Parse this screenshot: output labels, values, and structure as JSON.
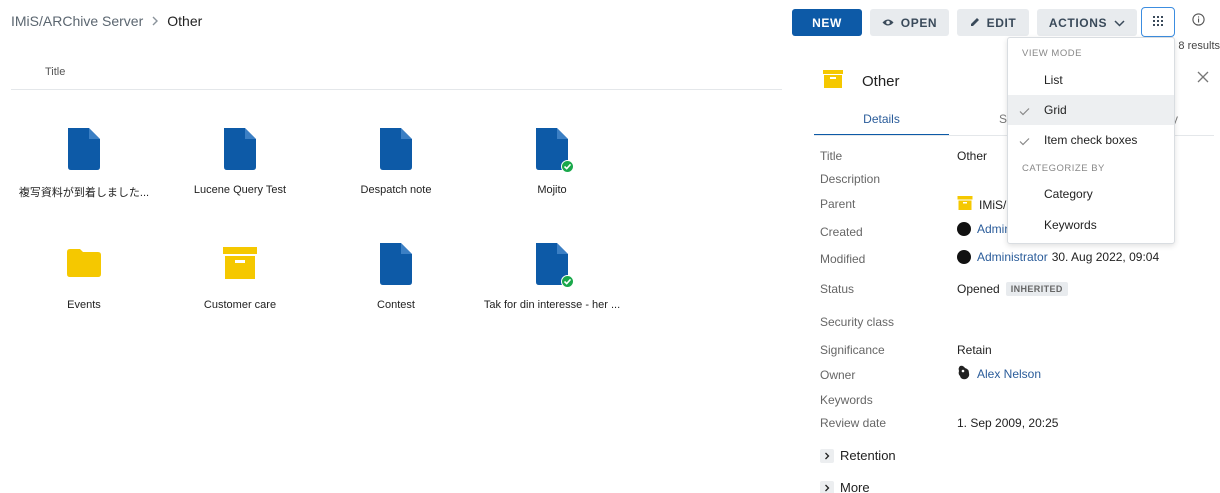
{
  "breadcrumb": {
    "root": "IMiS/ARChive Server",
    "current": "Other"
  },
  "list": {
    "column_title": "Title",
    "items": [
      {
        "label": "複写資料が到着しました...",
        "icon": "document-icon",
        "status_badge": false
      },
      {
        "label": "Lucene Query Test",
        "icon": "document-icon",
        "status_badge": false
      },
      {
        "label": "Despatch note",
        "icon": "document-icon",
        "status_badge": false
      },
      {
        "label": "Mojito",
        "icon": "document-icon",
        "status_badge": true
      },
      {
        "label": "Events",
        "icon": "folder-icon",
        "status_badge": false
      },
      {
        "label": "Customer care",
        "icon": "archive-box-icon",
        "status_badge": false
      },
      {
        "label": "Contest",
        "icon": "document-icon",
        "status_badge": false
      },
      {
        "label": "Tak for din interesse - her ...",
        "icon": "document-icon",
        "status_badge": true
      }
    ]
  },
  "toolbar": {
    "new_label": "NEW",
    "open_label": "OPEN",
    "edit_label": "EDIT",
    "actions_label": "ACTIONS",
    "results_text": "8 results"
  },
  "view_menu": {
    "view_mode_header": "VIEW MODE",
    "list_label": "List",
    "grid_label": "Grid",
    "grid_checked": true,
    "checkboxes_label": "Item check boxes",
    "checkboxes_checked": true,
    "categorize_header": "CATEGORIZE BY",
    "category_label": "Category",
    "keywords_label": "Keywords"
  },
  "detail": {
    "title": "Other",
    "tab_details": "Details",
    "tab_partial_s": "S",
    "tab_partial_y": "y",
    "labels": {
      "title": "Title",
      "description": "Description",
      "parent": "Parent",
      "created": "Created",
      "modified": "Modified",
      "status": "Status",
      "security_class": "Security class",
      "significance": "Significance",
      "owner": "Owner",
      "keywords": "Keywords",
      "review_date": "Review date"
    },
    "values": {
      "title": "Other",
      "parent": "IMiS/",
      "created_user": "Admin",
      "modified_user": "Administrator",
      "modified_date": "30. Aug 2022, 09:04",
      "status": "Opened",
      "status_tag": "INHERITED",
      "significance": "Retain",
      "owner": "Alex Nelson",
      "review_date": "1. Sep 2009, 20:25"
    },
    "sections": {
      "retention": "Retention",
      "more": "More"
    }
  },
  "colors": {
    "primary": "#0d5aa7",
    "document_icon": "#0d5aa7",
    "folder_icon": "#f5c800",
    "success": "#1aa84b"
  }
}
